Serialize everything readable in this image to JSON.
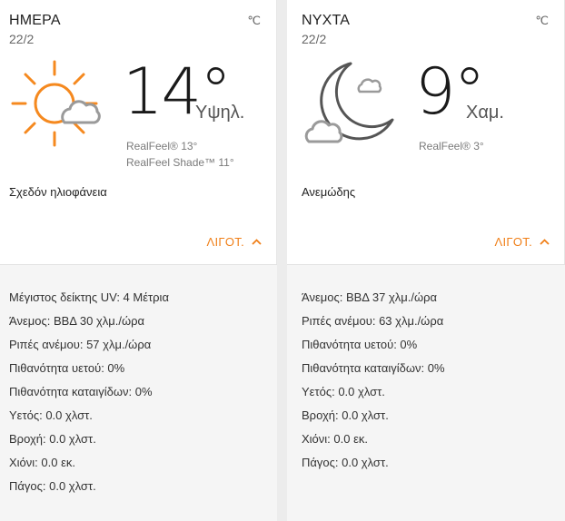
{
  "day": {
    "label": "ΗΜΕΡΑ",
    "date": "22/2",
    "unit": "℃",
    "icon": "partly-sunny-icon",
    "temp": "14°",
    "hilo": "Υψηλ.",
    "realfeel": "RealFeel® 13°",
    "realfeel_shade": "RealFeel Shade™ 11°",
    "phrase": "Σχεδόν ηλιοφάνεια",
    "less_label": "ΛΙΓΟΤ.",
    "details": [
      "Μέγιστος δείκτης UV: 4 Μέτρια",
      "Άνεμος: ΒΒΔ 30 χλμ./ώρα",
      "Ριπές ανέμου: 57 χλμ./ώρα",
      "Πιθανότητα υετού: 0%",
      "Πιθανότητα καταιγίδων: 0%",
      "Υετός: 0.0 χλστ.",
      "Βροχή: 0.0 χλστ.",
      "Χιόνι: 0.0 εκ.",
      "Πάγος: 0.0 χλστ."
    ]
  },
  "night": {
    "label": "ΝΥΧΤΑ",
    "date": "22/2",
    "unit": "℃",
    "icon": "partly-cloudy-night-icon",
    "temp": "9°",
    "hilo": "Χαμ.",
    "realfeel": "RealFeel® 3°",
    "phrase": "Ανεμώδης",
    "less_label": "ΛΙΓΟΤ.",
    "details": [
      "Άνεμος: ΒΒΔ 37 χλμ./ώρα",
      "Ριπές ανέμου: 63 χλμ./ώρα",
      "Πιθανότητα υετού: 0%",
      "Πιθανότητα καταιγίδων: 0%",
      "Υετός: 0.0 χλστ.",
      "Βροχή: 0.0 χλστ.",
      "Χιόνι: 0.0 εκ.",
      "Πάγος: 0.0 χλστ."
    ]
  },
  "colors": {
    "accent": "#f07f18",
    "sun": "#f5891f",
    "cloud": "#9a9a9a",
    "moon": "#555555"
  }
}
